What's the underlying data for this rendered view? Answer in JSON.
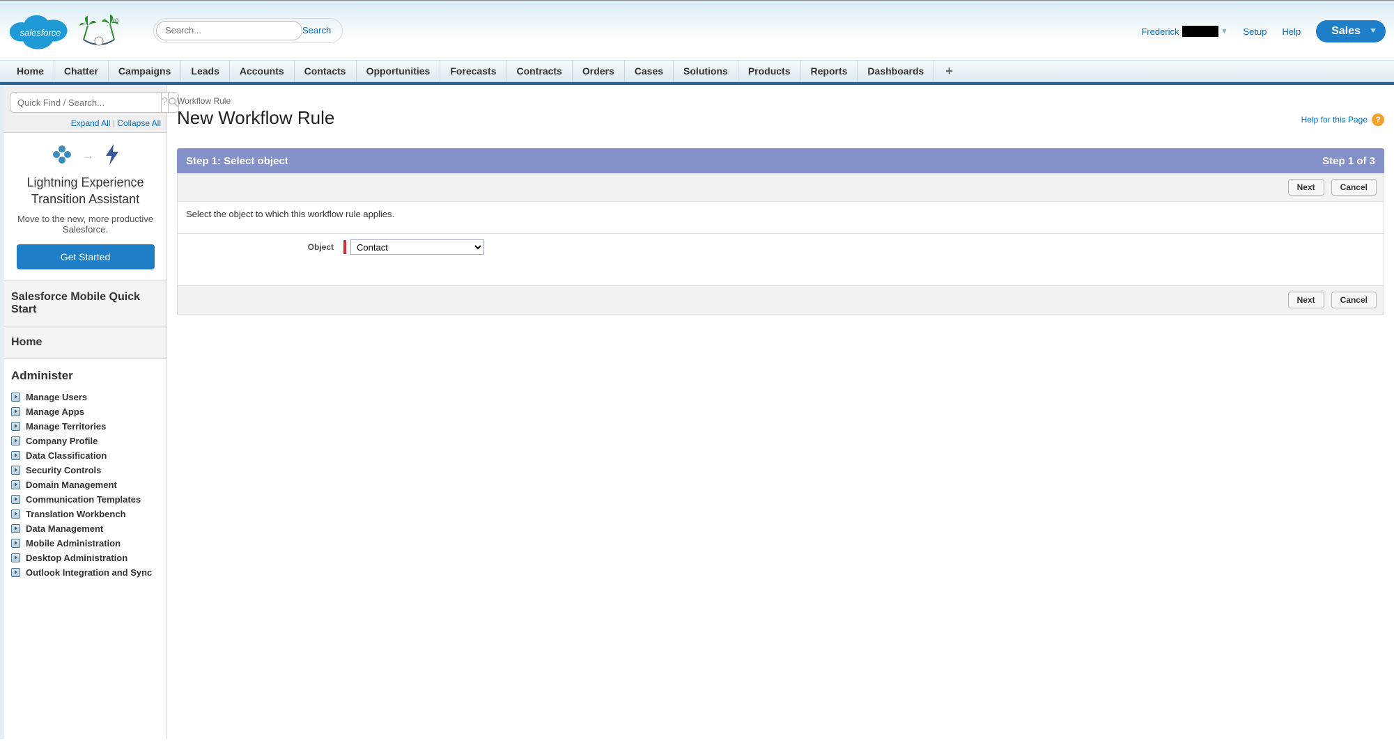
{
  "header": {
    "search_placeholder": "Search...",
    "search_btn": "Search",
    "user_name": "Frederick",
    "setup": "Setup",
    "help": "Help",
    "app": "Sales"
  },
  "tabs": [
    "Home",
    "Chatter",
    "Campaigns",
    "Leads",
    "Accounts",
    "Contacts",
    "Opportunities",
    "Forecasts",
    "Contracts",
    "Orders",
    "Cases",
    "Solutions",
    "Products",
    "Reports",
    "Dashboards"
  ],
  "sidebar": {
    "search_placeholder": "Quick Find / Search...",
    "expand": "Expand All",
    "collapse": "Collapse All",
    "promo_title": "Lightning Experience Transition Assistant",
    "promo_sub": "Move to the new, more productive Salesforce.",
    "promo_btn": "Get Started",
    "mobile": "Salesforce Mobile Quick Start",
    "home": "Home",
    "administer": "Administer",
    "admin_items": [
      "Manage Users",
      "Manage Apps",
      "Manage Territories",
      "Company Profile",
      "Data Classification",
      "Security Controls",
      "Domain Management",
      "Communication Templates",
      "Translation Workbench",
      "Data Management",
      "Mobile Administration",
      "Desktop Administration",
      "Outlook Integration and Sync"
    ]
  },
  "main": {
    "crumb": "Workflow Rule",
    "title": "New Workflow Rule",
    "help": "Help for this Page",
    "step_title": "Step 1: Select object",
    "step_count": "Step 1 of 3",
    "next": "Next",
    "cancel": "Cancel",
    "desc": "Select the object to which this workflow rule applies.",
    "object_label": "Object",
    "object_value": "Contact"
  }
}
